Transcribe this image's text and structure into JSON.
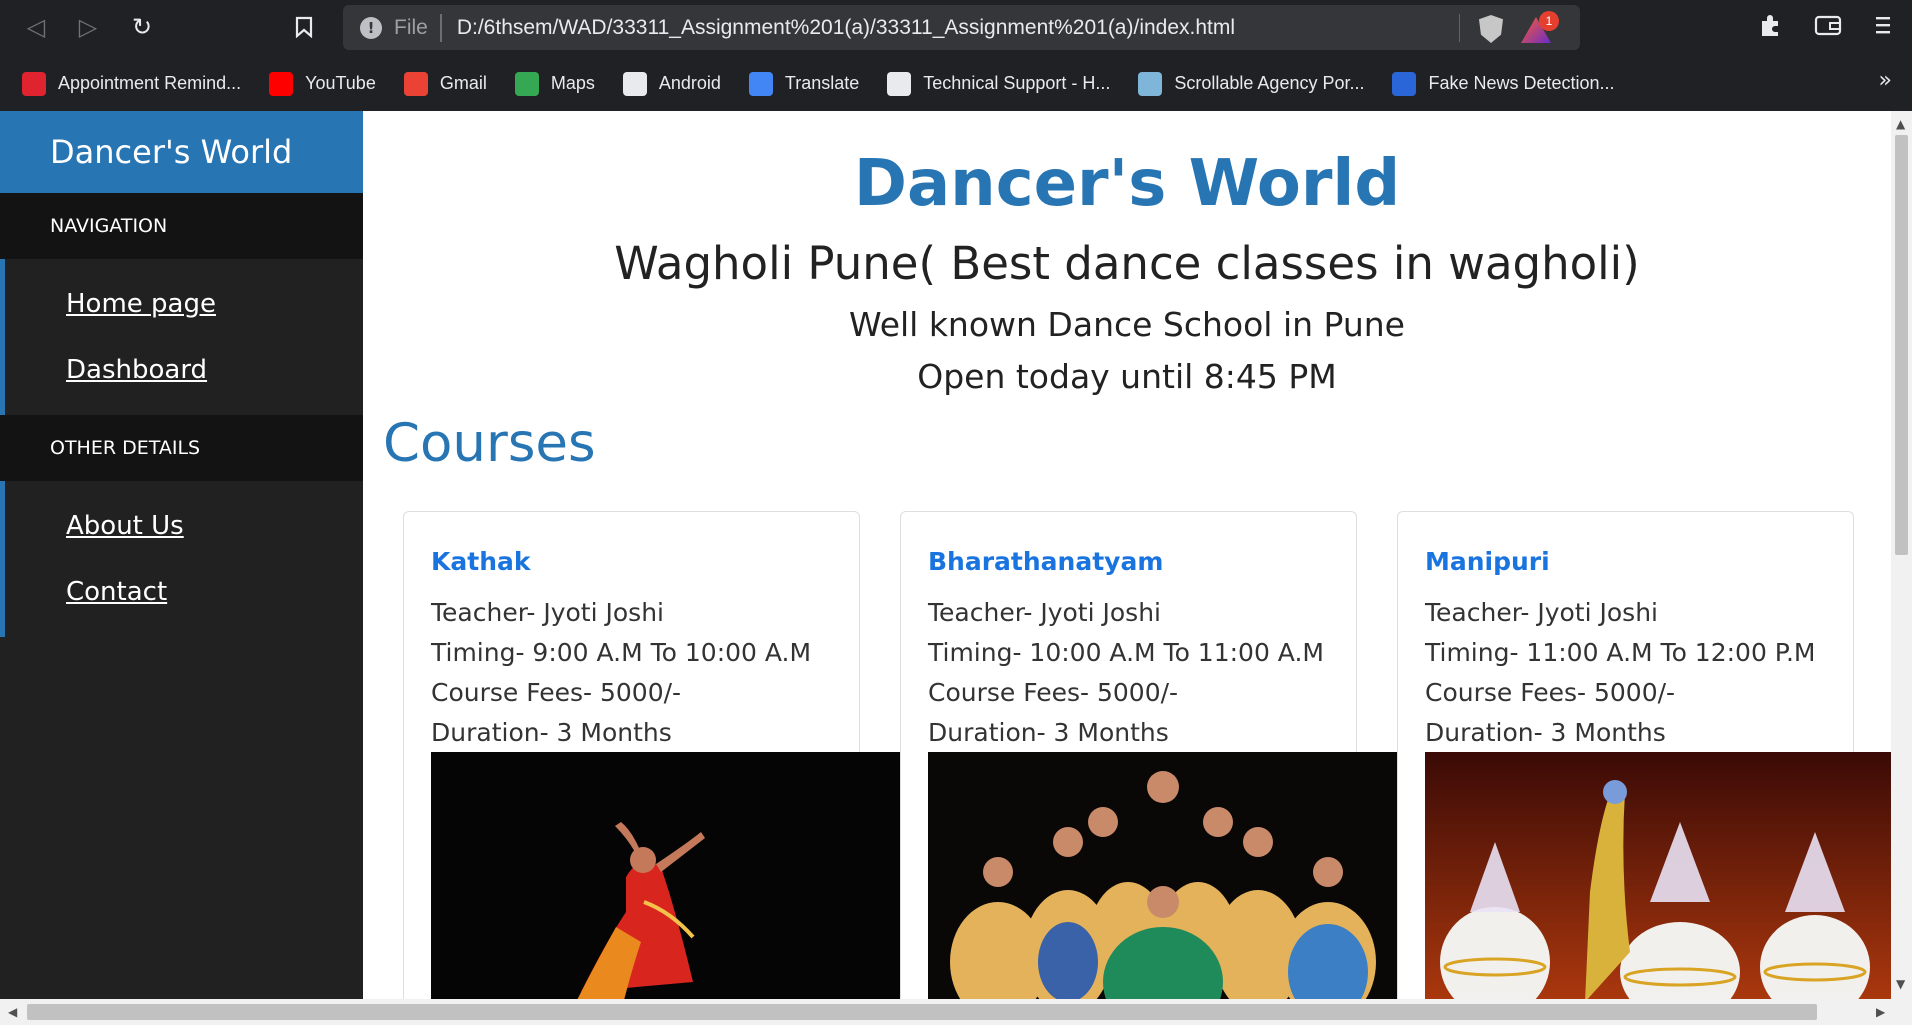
{
  "browser": {
    "url_scheme": "File",
    "url": "D:/6thsem/WAD/33311_Assignment%201(a)/33311_Assignment%201(a)/index.html",
    "notification_count": "1",
    "bookmarks": [
      {
        "label": "Appointment Remind...",
        "icon": "twilio-icon",
        "color": "#e0242f"
      },
      {
        "label": "YouTube",
        "icon": "youtube-icon",
        "color": "#ff0000"
      },
      {
        "label": "Gmail",
        "icon": "gmail-icon",
        "color": "#ea4335"
      },
      {
        "label": "Maps",
        "icon": "maps-pin-icon",
        "color": "#34a853"
      },
      {
        "label": "Android",
        "icon": "android-icon",
        "color": "#e8eaed"
      },
      {
        "label": "Translate",
        "icon": "translate-icon",
        "color": "#4285f4"
      },
      {
        "label": "Technical Support - H...",
        "icon": "globe-icon",
        "color": "#e8eaed"
      },
      {
        "label": "Scrollable Agency Por...",
        "icon": "page-thumbnail-icon",
        "color": "#7fb5d9"
      },
      {
        "label": "Fake News Detection...",
        "icon": "pycharm-icon",
        "color": "#2a66d8"
      }
    ]
  },
  "sidebar": {
    "brand": "Dancer's World",
    "sections": [
      {
        "title": "Navigation",
        "links": [
          "Home page",
          "Dashboard"
        ]
      },
      {
        "title": "Other Details",
        "links": [
          "About Us",
          "Contact"
        ]
      }
    ]
  },
  "hero": {
    "title": "Dancer's World",
    "subtitle": "Wagholi Pune( Best dance classes in wagholi)",
    "tagline": "Well known Dance School in Pune",
    "hours": "Open today until 8:45 PM"
  },
  "courses": {
    "heading": "Courses",
    "items": [
      {
        "name": "Kathak",
        "teacher": "Teacher- Jyoti Joshi",
        "timing": "Timing- 9:00 A.M To 10:00 A.M",
        "fees": "Course Fees- 5000/-",
        "duration": "Duration- 3 Months"
      },
      {
        "name": "Bharathanatyam",
        "teacher": "Teacher- Jyoti Joshi",
        "timing": "Timing- 10:00 A.M To 11:00 A.M",
        "fees": "Course Fees- 5000/-",
        "duration": "Duration- 3 Months"
      },
      {
        "name": "Manipuri",
        "teacher": "Teacher- Jyoti Joshi",
        "timing": "Timing- 11:00 A.M To 12:00 P.M",
        "fees": "Course Fees- 5000/-",
        "duration": "Duration- 3 Months"
      }
    ]
  },
  "colors": {
    "accent": "#2875b4",
    "link": "#1a74e0",
    "sidebar_bg": "#212121",
    "sidebar_head": "#131313"
  }
}
